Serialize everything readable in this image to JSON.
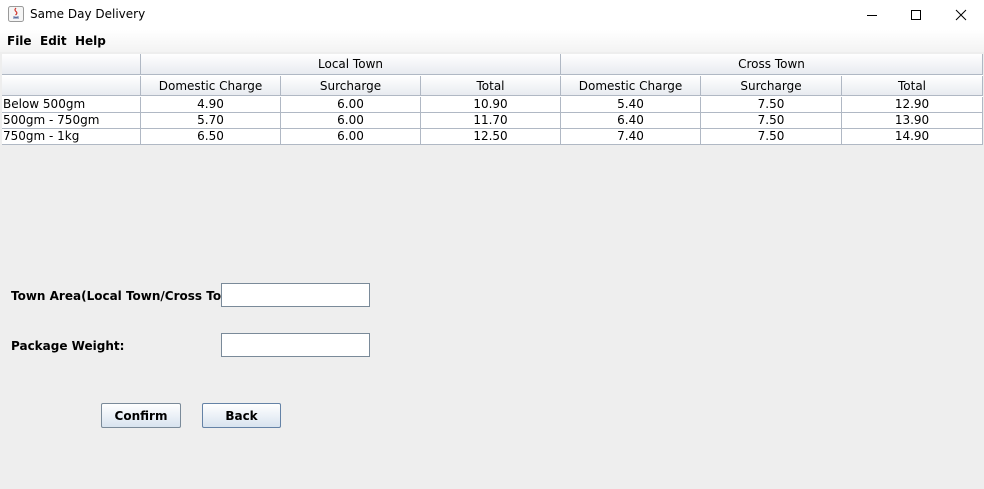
{
  "window": {
    "title": "Same Day Delivery"
  },
  "menu": {
    "file": "File",
    "edit": "Edit",
    "help": "Help"
  },
  "table": {
    "group_headers": [
      "",
      "Local Town",
      "Cross Town"
    ],
    "sub_headers": [
      "",
      "Domestic Charge",
      "Surcharge",
      "Total",
      "Domestic Charge",
      "Surcharge",
      "Total"
    ],
    "rows": [
      [
        "Below 500gm",
        "4.90",
        "6.00",
        "10.90",
        "5.40",
        "7.50",
        "12.90"
      ],
      [
        "500gm - 750gm",
        "5.70",
        "6.00",
        "11.70",
        "6.40",
        "7.50",
        "13.90"
      ],
      [
        "750gm - 1kg",
        "6.50",
        "6.00",
        "12.50",
        "7.40",
        "7.50",
        "14.90"
      ]
    ]
  },
  "form": {
    "town_area_label": "Town Area(Local Town/Cross Town):",
    "town_area_value": "",
    "weight_label": "Package Weight:",
    "weight_value": ""
  },
  "buttons": {
    "confirm": "Confirm",
    "back": "Back"
  }
}
